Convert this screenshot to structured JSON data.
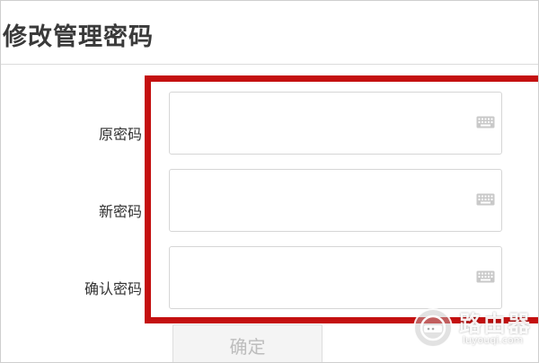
{
  "page": {
    "title": "修改管理密码"
  },
  "form": {
    "fields": [
      {
        "label": "原密码",
        "value": "",
        "icon": "keyboard-icon"
      },
      {
        "label": "新密码",
        "value": "",
        "icon": "keyboard-icon"
      },
      {
        "label": "确认密码",
        "value": "",
        "icon": "keyboard-icon"
      }
    ],
    "submit_label": "确定"
  },
  "annotation": {
    "highlight_color": "#c41010"
  },
  "watermark": {
    "name": "路由器",
    "domain": "luyouqi.com"
  }
}
